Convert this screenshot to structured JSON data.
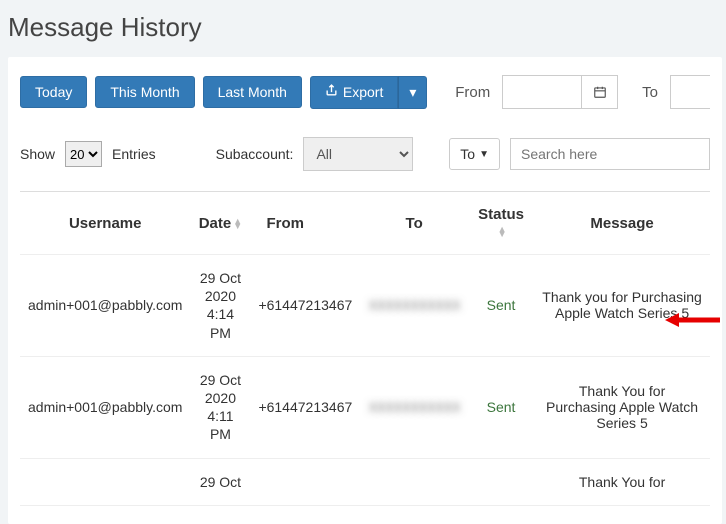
{
  "page": {
    "title": "Message History"
  },
  "toolbar": {
    "today": "Today",
    "thisMonth": "This Month",
    "lastMonth": "Last Month",
    "export": "Export",
    "fromLabel": "From",
    "toLabel": "To"
  },
  "filters": {
    "showLabel": "Show",
    "entriesLabel": "Entries",
    "pageSize": "20",
    "subaccountLabel": "Subaccount:",
    "subaccountValue": "All",
    "directionValue": "To",
    "searchPlaceholder": "Search here"
  },
  "table": {
    "headers": {
      "username": "Username",
      "date": "Date",
      "from": "From",
      "to": "To",
      "status": "Status",
      "message": "Message"
    },
    "rows": [
      {
        "username": "admin+001@pabbly.com",
        "date": "29 Oct 2020 4:14 PM",
        "from": "+61447213467",
        "to": "XXXXXXXXXXX",
        "status": "Sent",
        "message": "Thank you for Purchasing Apple Watch Series 5"
      },
      {
        "username": "admin+001@pabbly.com",
        "date": "29 Oct 2020 4:11 PM",
        "from": "+61447213467",
        "to": "XXXXXXXXXXX",
        "status": "Sent",
        "message": "Thank You for Purchasing Apple Watch Series 5"
      },
      {
        "username": "",
        "date": "29 Oct",
        "from": "",
        "to": "",
        "status": "",
        "message": "Thank You for"
      }
    ]
  }
}
